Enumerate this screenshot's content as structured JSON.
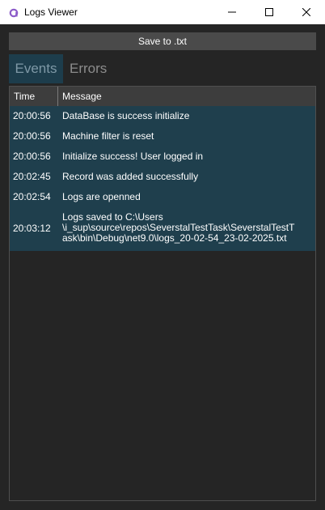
{
  "window": {
    "title": "Logs Viewer",
    "controls": {
      "minimize": "minimize-icon",
      "maximize": "maximize-icon",
      "close": "close-icon"
    }
  },
  "toolbar": {
    "save_label": "Save to .txt"
  },
  "tabs": [
    {
      "label": "Events",
      "selected": true
    },
    {
      "label": "Errors",
      "selected": false
    }
  ],
  "grid": {
    "columns": [
      "Time",
      "Message"
    ],
    "rows": [
      {
        "time": "20:00:56",
        "message_lines": [
          "DataBase is success initialize"
        ]
      },
      {
        "time": "20:00:56",
        "message_lines": [
          "Machine filter is reset"
        ]
      },
      {
        "time": "20:00:56",
        "message_lines": [
          "Initialize success! User logged in"
        ]
      },
      {
        "time": "20:02:45",
        "message_lines": [
          "Record was added successfully"
        ]
      },
      {
        "time": "20:02:54",
        "message_lines": [
          "Logs are openned"
        ]
      },
      {
        "time": "20:03:12",
        "message_lines": [
          "Logs saved to C:\\Users",
          "\\i_sup\\source\\repos\\SeverstalTestTask\\SeverstalTestT",
          "ask\\bin\\Debug\\net9.0\\logs_20-02-54_23-02-2025.txt"
        ]
      }
    ]
  },
  "colors": {
    "window_bg": "#252525",
    "selected_row_bg": "#1f3f4d",
    "tab_selected_bg": "#1d3d4c",
    "header_bg": "#3d3d3d",
    "app_icon": "#8c5cc9"
  }
}
